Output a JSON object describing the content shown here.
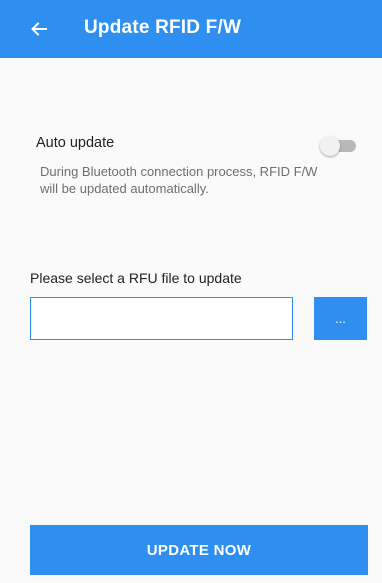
{
  "app_bar": {
    "title": "Update RFID F/W",
    "back_icon": "arrow-left-icon",
    "color": "#2f8ff0"
  },
  "auto_update": {
    "label": "Auto update",
    "enabled": false,
    "description": "During Bluetooth connection process, RFID F/W will be updated automatically."
  },
  "file_select": {
    "label": "Please select a RFU file to update",
    "value": "",
    "browse_label": "..."
  },
  "actions": {
    "update_label": "UPDATE NOW"
  }
}
